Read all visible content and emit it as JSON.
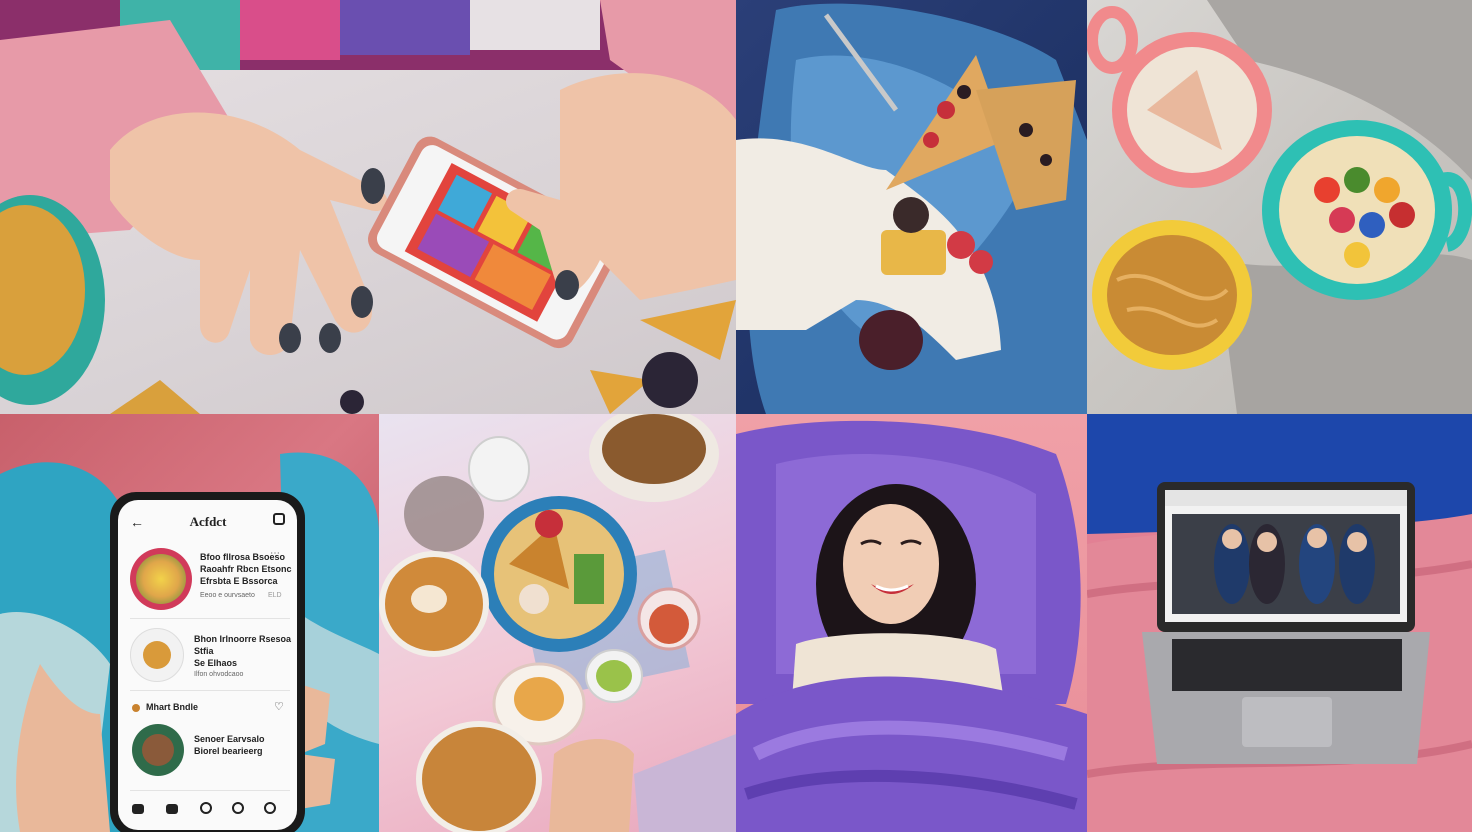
{
  "tiles": [
    {
      "name": "tile-hands-scrolling-phone"
    },
    {
      "name": "tile-snacks-on-blue-blanket"
    },
    {
      "name": "tile-bowls-of-snacks"
    },
    {
      "name": "tile-hand-holding-phone-app"
    },
    {
      "name": "tile-food-table-overhead"
    },
    {
      "name": "tile-woman-smiling-in-bed"
    },
    {
      "name": "tile-laptop-on-bed"
    }
  ],
  "phone_app": {
    "title": "Acfdct",
    "item1_title": "Bfoo fllrosa Bsoeso",
    "item1_line2": "Raoahfr Rbcn Etsonc",
    "item1_line3": "Efrsbta E Bssorca",
    "item1_meta": "Eeoo e ourvsaeto",
    "item1_count": "ELD",
    "item2_title": "Bhon Irlnoorre Rsesoa",
    "item2_line2": "Stfia",
    "item2_line3": "Se Elhaos",
    "item2_meta": "Ilfon ohvodcaoo",
    "section_label": "Mhart Bndle",
    "item3_title": "Senoer Earvsalo",
    "item3_line2": "Biorel bearieerg"
  },
  "colors": {
    "nail_polish": "#3a3f4a",
    "blanket_blue": "#3f79b3",
    "blanket_purple": "#7a57c9",
    "sheet_pink": "#e88d98"
  }
}
